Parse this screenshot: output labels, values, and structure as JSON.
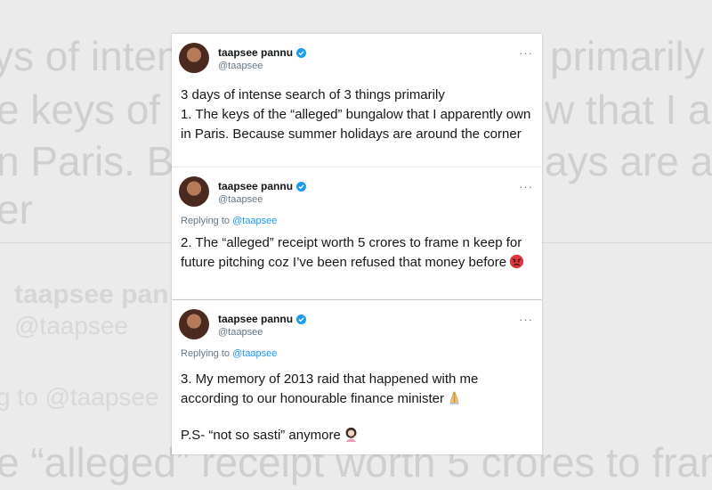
{
  "background": {
    "lines": [
      "ys of inten",
      "primarily",
      "e keys of t",
      "w that I ap",
      "n Paris. Be",
      "ays are ar",
      "er"
    ],
    "name": "taapsee pan",
    "handle": "@taapsee",
    "reply": "g to @taapsee",
    "bottom": "e “alleged” receipt worth 5 crores to fram"
  },
  "tweets": [
    {
      "display_name": "taapsee pannu",
      "handle": "@taapsee",
      "more": "···",
      "lines": [
        "3 days of intense search of 3 things primarily",
        "1. The keys of the “alleged” bungalow that I apparently own in Paris. Because summer holidays are around the corner"
      ]
    },
    {
      "display_name": "taapsee pannu",
      "handle": "@taapsee",
      "more": "···",
      "replying_prefix": "Replying to ",
      "replying_to": "@taapsee",
      "lines": [
        "2. The “alleged” receipt worth 5 crores to frame n keep for future pitching coz I’ve been refused that money before"
      ],
      "emoji": "angry-face-emoji"
    },
    {
      "display_name": "taapsee pannu",
      "handle": "@taapsee",
      "more": "···",
      "replying_prefix": "Replying to ",
      "replying_to": "@taapsee",
      "lines": [
        "3. My memory of 2013 raid that happened with me according to our honourable finance minister",
        "P.S- “not so sasti” anymore"
      ],
      "emojis": [
        "folded-hands-emoji",
        "woman-tipping-hand-emoji"
      ]
    }
  ],
  "colors": {
    "verified": "#1d9bf0",
    "link": "#1d9bf0",
    "text": "#14171a",
    "muted": "#657786"
  }
}
